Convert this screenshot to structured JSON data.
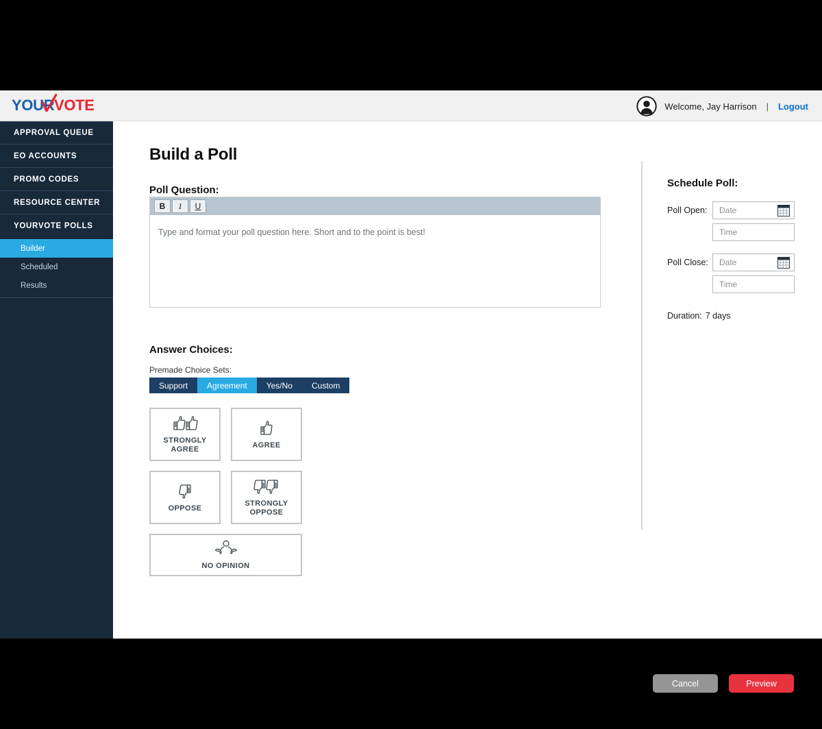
{
  "colors": {
    "sidebar_bg": "#18293a",
    "accent_blue": "#29abe2",
    "brand_blue": "#1b5fab",
    "brand_red": "#e8242f",
    "preview_red": "#e8333f",
    "cancel_gray": "#959595",
    "tabbar_navy": "#1c3f63"
  },
  "header": {
    "logo_first": "YOUR",
    "logo_second": "VOTE",
    "logo_icon": "checkmark-icon",
    "avatar_icon": "user-avatar-icon",
    "welcome": "Welcome, Jay Harrison",
    "separator": "|",
    "logout": "Logout"
  },
  "sidebar": {
    "items": [
      {
        "label": "APPROVAL QUEUE",
        "name": "approval-queue"
      },
      {
        "label": "EO ACCOUNTS",
        "name": "eo-accounts"
      },
      {
        "label": "PROMO CODES",
        "name": "promo-codes"
      },
      {
        "label": "RESOURCE CENTER",
        "name": "resource-center"
      },
      {
        "label": "YOURVOTE POLLS",
        "name": "yourvote-polls"
      }
    ],
    "sub_items": [
      {
        "label": "Builder",
        "active": true
      },
      {
        "label": "Scheduled",
        "active": false
      },
      {
        "label": "Results",
        "active": false
      }
    ]
  },
  "main": {
    "page_title": "Build a Poll",
    "poll_question": {
      "label": "Poll Question:",
      "toolbar": {
        "bold": "B",
        "italic": "I",
        "underline": "U"
      },
      "value": "",
      "placeholder": "Type and format your poll question here. Short and to the point is best!"
    },
    "answer_choices": {
      "label": "Answer Choices:",
      "premade_label": "Premade Choice Sets:",
      "tabs": [
        {
          "label": "Support",
          "active": false
        },
        {
          "label": "Agreement",
          "active": true
        },
        {
          "label": "Yes/No",
          "active": false
        },
        {
          "label": "Custom",
          "active": false
        }
      ],
      "cards": [
        {
          "label": "STRONGLY AGREE",
          "icon": "double-thumbs-up-icon"
        },
        {
          "label": "AGREE",
          "icon": "thumbs-up-icon"
        },
        {
          "label": "OPPOSE",
          "icon": "thumbs-down-icon"
        },
        {
          "label": "STRONGLY OPPOSE",
          "icon": "double-thumbs-down-icon"
        },
        {
          "label": "NO OPINION",
          "icon": "shrug-person-icon"
        }
      ]
    }
  },
  "schedule": {
    "title": "Schedule Poll:",
    "open_label": "Poll Open:",
    "close_label": "Poll Close:",
    "open_date": {
      "value": "",
      "placeholder": "Date"
    },
    "open_time": {
      "value": "",
      "placeholder": "Time"
    },
    "close_date": {
      "value": "",
      "placeholder": "Date"
    },
    "close_time": {
      "value": "",
      "placeholder": "Time"
    },
    "calendar_icon": "calendar-icon",
    "duration_label": "Duration:",
    "duration_value": "7 days"
  },
  "actions": {
    "cancel": "Cancel",
    "preview": "Preview"
  }
}
